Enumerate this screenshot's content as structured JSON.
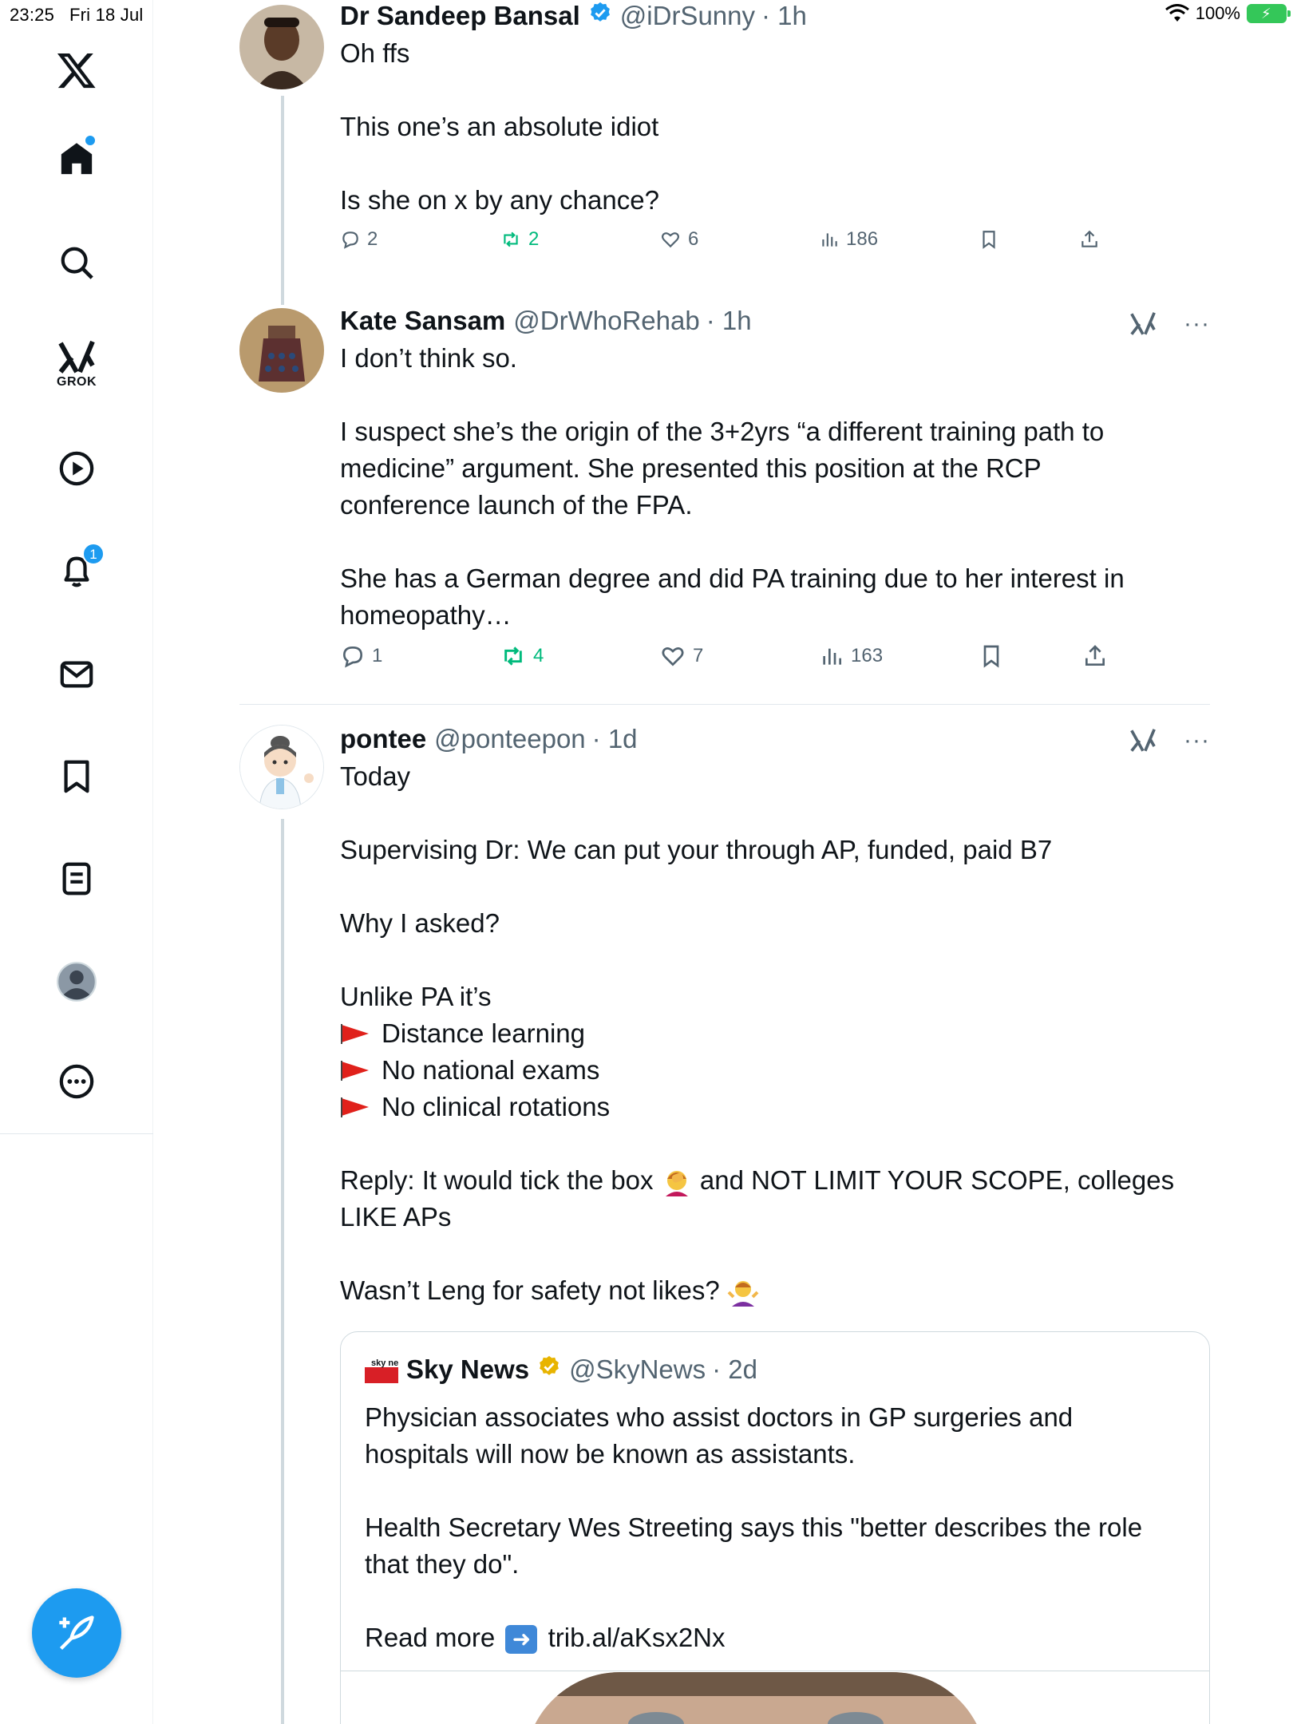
{
  "status_bar": {
    "time": "23:25",
    "date": "Fri 18 Jul",
    "battery": "100%"
  },
  "sidebar": {
    "items": [
      {
        "name": "x-logo-icon"
      },
      {
        "name": "home-icon"
      },
      {
        "name": "search-icon"
      },
      {
        "name": "grok-icon",
        "label": "GROK"
      },
      {
        "name": "video-icon"
      },
      {
        "name": "notifications-icon",
        "badge": "1"
      },
      {
        "name": "messages-icon"
      },
      {
        "name": "bookmarks-icon"
      },
      {
        "name": "lists-icon"
      },
      {
        "name": "profile-icon"
      },
      {
        "name": "more-icon"
      }
    ],
    "compose": "compose-icon"
  },
  "tweets": [
    {
      "name": "Dr Sandeep Bansal",
      "handle": "@iDrSunny",
      "time": "· 1h",
      "verified": true,
      "lines": [
        "Oh ffs",
        "",
        "This one’s an absolute idiot",
        "",
        "Is she on x by any chance?"
      ],
      "replies": "2",
      "reposts": "2",
      "likes": "6",
      "views": "186"
    },
    {
      "name": "Kate Sansam",
      "handle": "@DrWhoRehab",
      "time": "· 1h",
      "lines": [
        "I don’t think so.",
        "",
        "I suspect she’s the origin of the 3+2yrs “a different training path to",
        "medicine” argument. She presented this position at the RCP",
        "conference launch of the FPA.",
        "",
        "She has a German degree and did PA training due to her interest in",
        "homeopathy…"
      ],
      "replies": "1",
      "reposts": "4",
      "likes": "7",
      "views": "163"
    },
    {
      "name": "pontee",
      "handle": "@ponteepon",
      "time": "· 1d",
      "lines": {
        "l1": "Today",
        "l2": "Supervising Dr: We can put your through AP, funded, paid B7",
        "l3": "Why I asked?",
        "l4": "Unlike PA it’s",
        "flag1": "Distance learning",
        "flag2": "No national exams",
        "flag3": "No clinical rotations",
        "l5a": "Reply: It would tick the box",
        "l5b": "and NOT LIMIT YOUR SCOPE, colleges",
        "l6": "LIKE APs",
        "l7": "Wasn’t Leng for safety not likes?"
      },
      "quote": {
        "logo_text": "sky news",
        "name": "Sky News",
        "handle": "@SkyNews",
        "time": "· 2d",
        "lines": [
          "Physician associates who assist doctors in GP surgeries and",
          "hospitals will now be known as assistants.",
          "",
          "Health Secretary Wes Streeting says this \"better describes the role",
          "that they do\".",
          ""
        ],
        "read_more": "Read more",
        "link": "trib.al/aKsx2Nx"
      }
    }
  ],
  "colors": {
    "accent": "#1d9bf0",
    "repost": "#00ba7c",
    "muted": "#536471",
    "verified_gold": "#e8b400"
  }
}
